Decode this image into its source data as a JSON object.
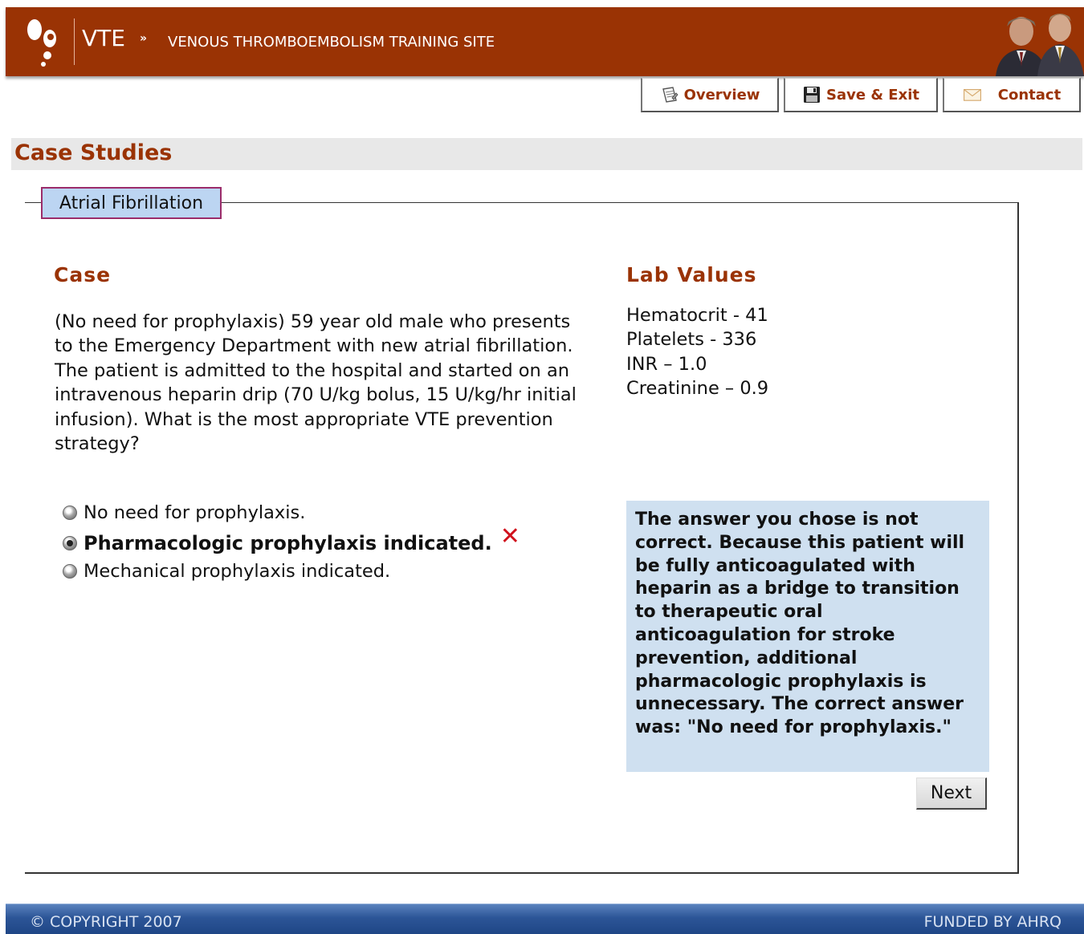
{
  "header": {
    "site_abbr": "VTE",
    "separator": "»",
    "site_name": "VENOUS THROMBOEMBOLISM TRAINING SITE",
    "brand_color": "#9a3304"
  },
  "toolbar": {
    "overview_label": "Overview",
    "save_exit_label": "Save & Exit",
    "contact_label": "Contact"
  },
  "page": {
    "title": "Case Studies"
  },
  "case_study": {
    "legend": "Atrial Fibrillation",
    "case_heading": "Case",
    "case_text": "(No need for prophylaxis) 59 year old male who presents to the Emergency Department with new atrial fibrillation. The patient is admitted to the hospital and started on an intravenous heparin drip (70 U/kg bolus, 15 U/kg/hr initial infusion). What is the most appropriate VTE prevention strategy?",
    "lab_heading": "Lab Values",
    "lab_values": [
      "Hematocrit - 41",
      "Platelets - 336",
      "INR – 1.0",
      "Creatinine – 0.9"
    ]
  },
  "options": [
    {
      "label": "No need for prophylaxis.",
      "selected": false
    },
    {
      "label": "Pharmacologic prophylaxis indicated.",
      "selected": true,
      "marked_incorrect": true
    },
    {
      "label": "Mechanical prophylaxis indicated.",
      "selected": false
    }
  ],
  "feedback": {
    "text": "The answer you chose is not correct. Because this patient will be fully anticoagulated with heparin as a bridge to transition to therapeutic oral anticoagulation for stroke prevention, additional pharmacologic prophylaxis is unnecessary. The correct answer was: \"No need for prophylaxis.\"",
    "background": "#cfe0f0"
  },
  "next_label": "Next",
  "footer": {
    "copyright": "© COPYRIGHT 2007",
    "funding": "FUNDED BY AHRQ"
  }
}
